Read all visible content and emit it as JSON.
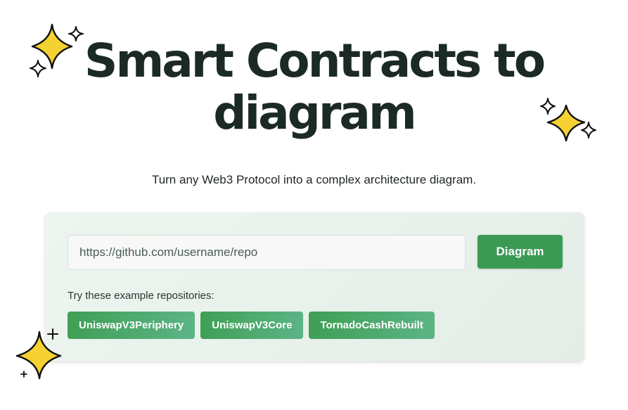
{
  "header": {
    "title_line1": "Smart Contracts to",
    "title_line2": "diagram",
    "subtitle": "Turn any Web3 Protocol into a complex architecture diagram."
  },
  "form": {
    "input_placeholder": "https://github.com/username/repo",
    "input_value": "",
    "submit_label": "Diagram"
  },
  "examples": {
    "label": "Try these example repositories:",
    "items": [
      {
        "label": "UniswapV3Periphery"
      },
      {
        "label": "UniswapV3Core"
      },
      {
        "label": "TornadoCashRebuilt"
      }
    ]
  },
  "decorations": {
    "icons": [
      "sparkle-icon",
      "sparkle-icon",
      "sparkle-icon",
      "plus-icon"
    ]
  },
  "colors": {
    "title": "#1b2a24",
    "accent_green": "#3a9a54",
    "card_background": "#e8f1eb",
    "sparkle_fill": "#f5d232"
  }
}
